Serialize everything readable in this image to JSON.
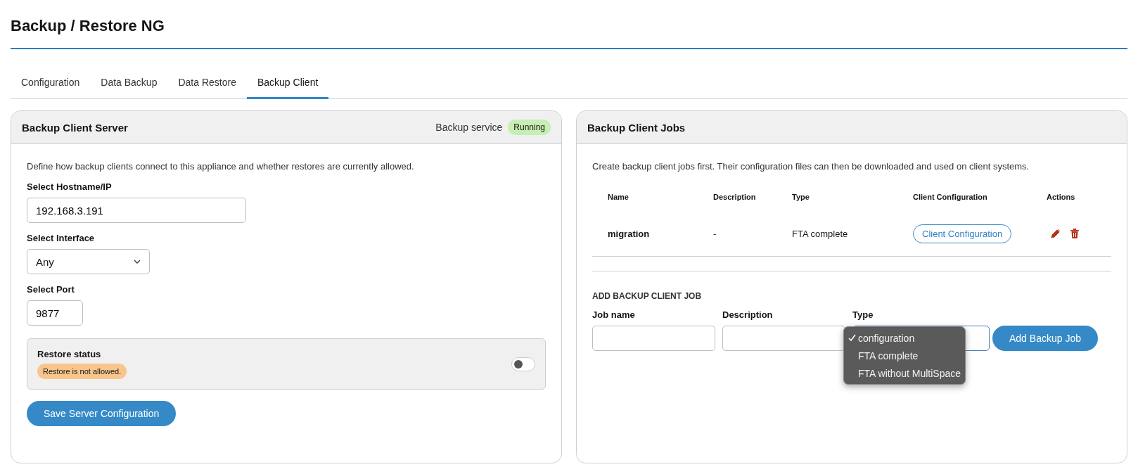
{
  "page": {
    "title": "Backup / Restore NG"
  },
  "tabs": [
    {
      "label": "Configuration",
      "selected": false
    },
    {
      "label": "Data Backup",
      "selected": false
    },
    {
      "label": "Data Restore",
      "selected": false
    },
    {
      "label": "Backup Client",
      "selected": true
    }
  ],
  "server_panel": {
    "title": "Backup Client Server",
    "service_label": "Backup service",
    "service_status": "Running",
    "service_running": true,
    "intro": "Define how backup clients connect to this appliance and whether restores are currently allowed.",
    "hostname": {
      "label": "Select Hostname/IP",
      "value": "192.168.3.191"
    },
    "interface": {
      "label": "Select Interface",
      "value": "Any"
    },
    "port": {
      "label": "Select Port",
      "value": "9877"
    },
    "restore": {
      "label": "Restore status",
      "badge": "Restore is not allowed.",
      "on": false
    },
    "save_button": "Save Server Configuration"
  },
  "jobs_panel": {
    "title": "Backup Client Jobs",
    "intro": "Create backup client jobs first. Their configuration files can then be downloaded and used on client systems.",
    "table": {
      "columns": [
        "Name",
        "Description",
        "Type",
        "Client Configuration",
        "Actions"
      ],
      "rows": [
        {
          "name": "migration",
          "description": "-",
          "type": "FTA complete",
          "config_button": "Client Configuration"
        }
      ]
    },
    "add_heading": "ADD BACKUP CLIENT JOB",
    "job_name": {
      "label": "Job name"
    },
    "description": {
      "label": "Description"
    },
    "type": {
      "label": "Type",
      "options": [
        {
          "label": "configuration",
          "selected": true
        },
        {
          "label": "FTA complete",
          "selected": false
        },
        {
          "label": "FTA without MultiSpace",
          "selected": false
        }
      ]
    },
    "add_button": "Add Backup Job"
  }
}
